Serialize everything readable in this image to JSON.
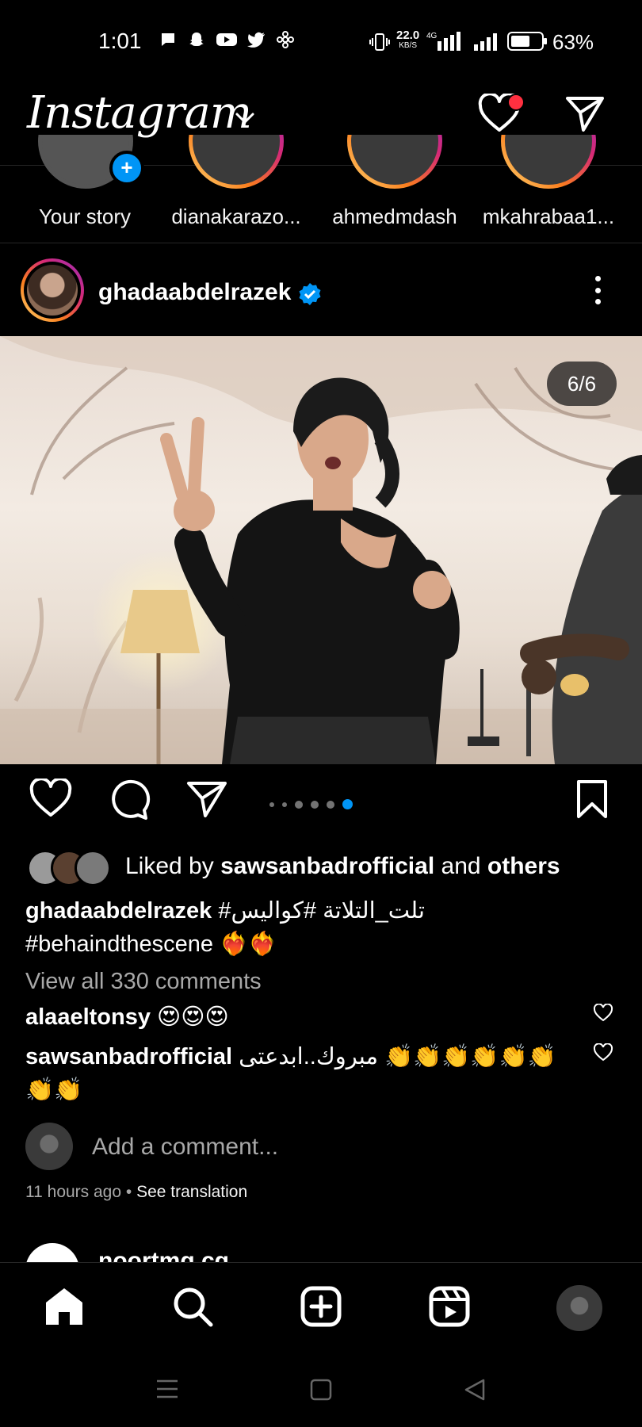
{
  "status_bar": {
    "time": "1:01",
    "net_speed_value": "22.0",
    "net_speed_unit": "KB/S",
    "battery_percent": "63%",
    "battery_level": 0.63
  },
  "header": {
    "logo_text": "Instagram",
    "notification_color": "#ff3040"
  },
  "stories": [
    {
      "label": "Your story",
      "own": true
    },
    {
      "label": "dianakarazo..."
    },
    {
      "label": "ahmedmdash"
    },
    {
      "label": "mkahrabaa1..."
    }
  ],
  "post": {
    "username": "ghadaabdelrazek",
    "photo_counter": "6/6",
    "carousel_dots": 6,
    "active_dot": 6,
    "liked_prefix": "Liked by ",
    "liked_user": "sawsanbadrofficial",
    "liked_middle": " and ",
    "liked_others": "others",
    "caption_user": "ghadaabdelrazek",
    "caption_text": " #تلت_التلاتة #كواليس",
    "caption_line2": "#behaindthescene",
    "caption_emoji": "❤️‍🔥❤️‍🔥",
    "view_comments": "View all 330 comments",
    "comments": [
      {
        "user": "alaaeltonsy",
        "text": " 😍😍😍"
      },
      {
        "user": "sawsanbadrofficial",
        "text": " مبروك..ابدعتى 👏👏👏👏👏👏👏👏"
      }
    ],
    "add_comment_placeholder": "Add a comment...",
    "time_ago": "11 hours ago",
    "separator": " • ",
    "see_translation": "See translation"
  },
  "next_post": {
    "username": "noortmq.cg"
  },
  "accent_color": "#0095f6",
  "verified_color": "#0095f6"
}
